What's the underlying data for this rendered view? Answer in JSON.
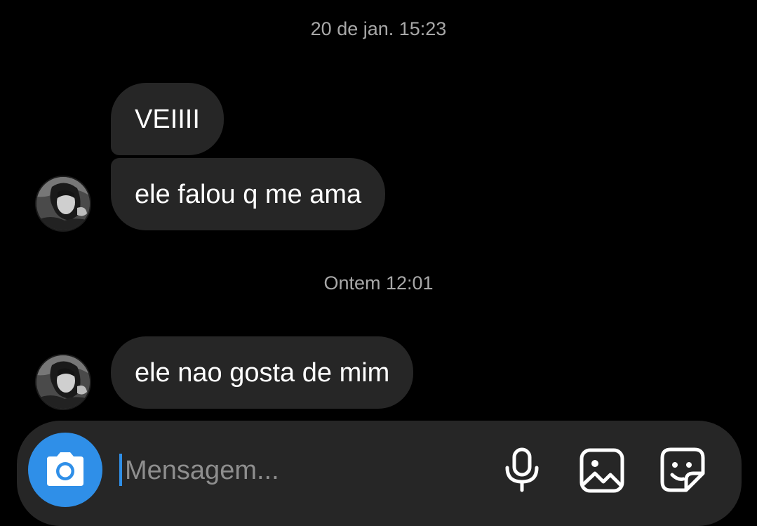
{
  "thread": {
    "separators": [
      "20 de jan. 15:23",
      "Ontem 12:01"
    ],
    "messages": [
      {
        "text": "VEIIII"
      },
      {
        "text": "ele falou q me ama"
      },
      {
        "text": "ele nao gosta de mim"
      }
    ]
  },
  "composer": {
    "placeholder": "Mensagem...",
    "icons": [
      "camera-icon",
      "microphone-icon",
      "gallery-icon",
      "sticker-icon"
    ],
    "accent_color": "#2f8fe8"
  },
  "colors": {
    "background": "#000000",
    "bubble": "#262626",
    "timestamp": "#a8a8a8"
  }
}
